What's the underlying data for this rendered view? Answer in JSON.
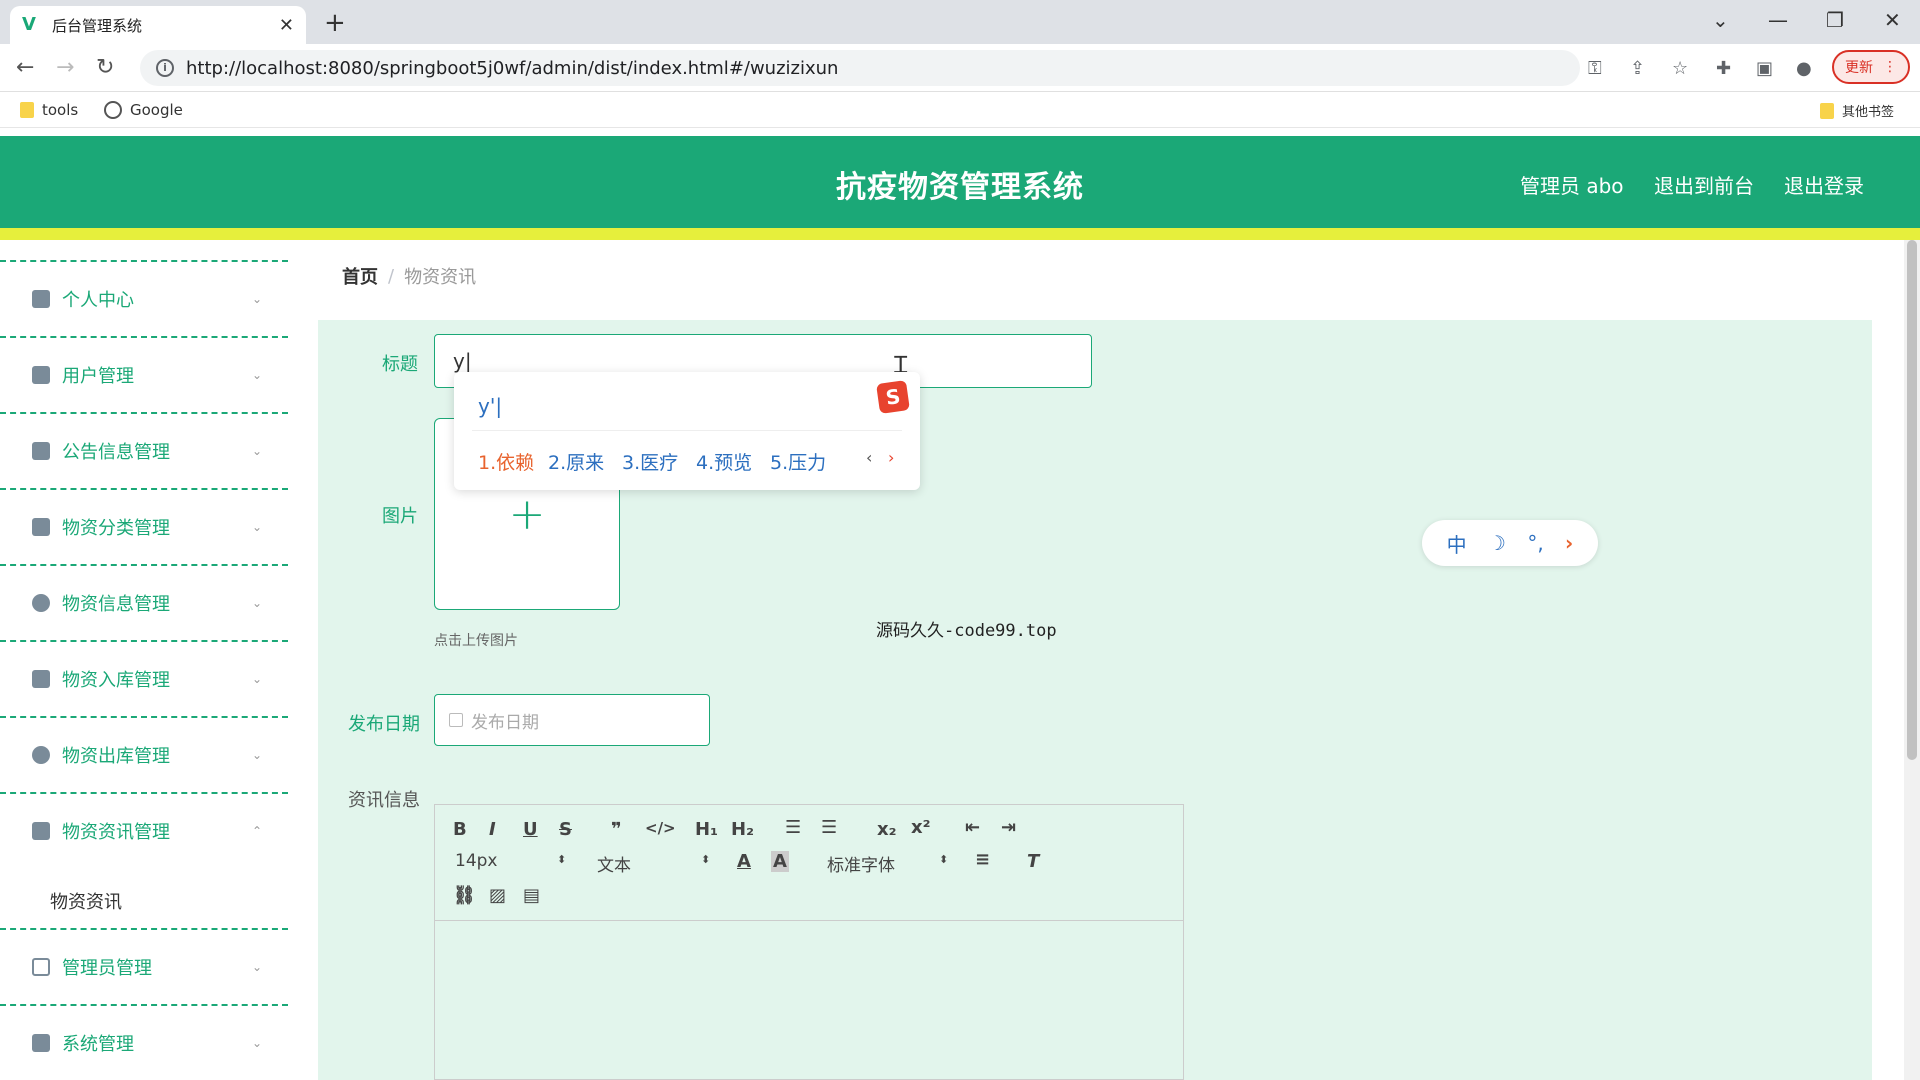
{
  "browser": {
    "tab_title": "后台管理系统",
    "url": "http://localhost:8080/springboot5j0wf/admin/dist/index.html#/wuzizixun",
    "update_label": "更新",
    "bookmarks": [
      "tools",
      "Google"
    ],
    "other_bookmarks": "其他书签"
  },
  "header": {
    "title": "抗疫物资管理系统",
    "user": "管理员 abo",
    "back_to_front": "退出到前台",
    "logout": "退出登录"
  },
  "sidebar": {
    "items": [
      {
        "label": "个人中心"
      },
      {
        "label": "用户管理"
      },
      {
        "label": "公告信息管理"
      },
      {
        "label": "物资分类管理"
      },
      {
        "label": "物资信息管理"
      },
      {
        "label": "物资入库管理"
      },
      {
        "label": "物资出库管理"
      },
      {
        "label": "物资资讯管理"
      },
      {
        "label": "管理员管理"
      },
      {
        "label": "系统管理"
      }
    ],
    "sub_item": "物资资讯"
  },
  "breadcrumb": {
    "home": "首页",
    "sep": "/",
    "current": "物资资讯"
  },
  "form": {
    "title_label": "标题",
    "title_value": "y|",
    "image_label": "图片",
    "upload_tip": "点击上传图片",
    "date_label": "发布日期",
    "date_placeholder": "发布日期",
    "info_label": "资讯信息"
  },
  "editor": {
    "font_size": "14px",
    "paragraph": "文本",
    "font_family": "标准字体"
  },
  "overlay_text": "源码久久-code99.top",
  "ime": {
    "composition": "y'|",
    "candidates": [
      "1.依赖",
      "2.原来",
      "3.医疗",
      "4.预览",
      "5.压力"
    ],
    "bar": [
      "中",
      "☽",
      "°,"
    ]
  }
}
